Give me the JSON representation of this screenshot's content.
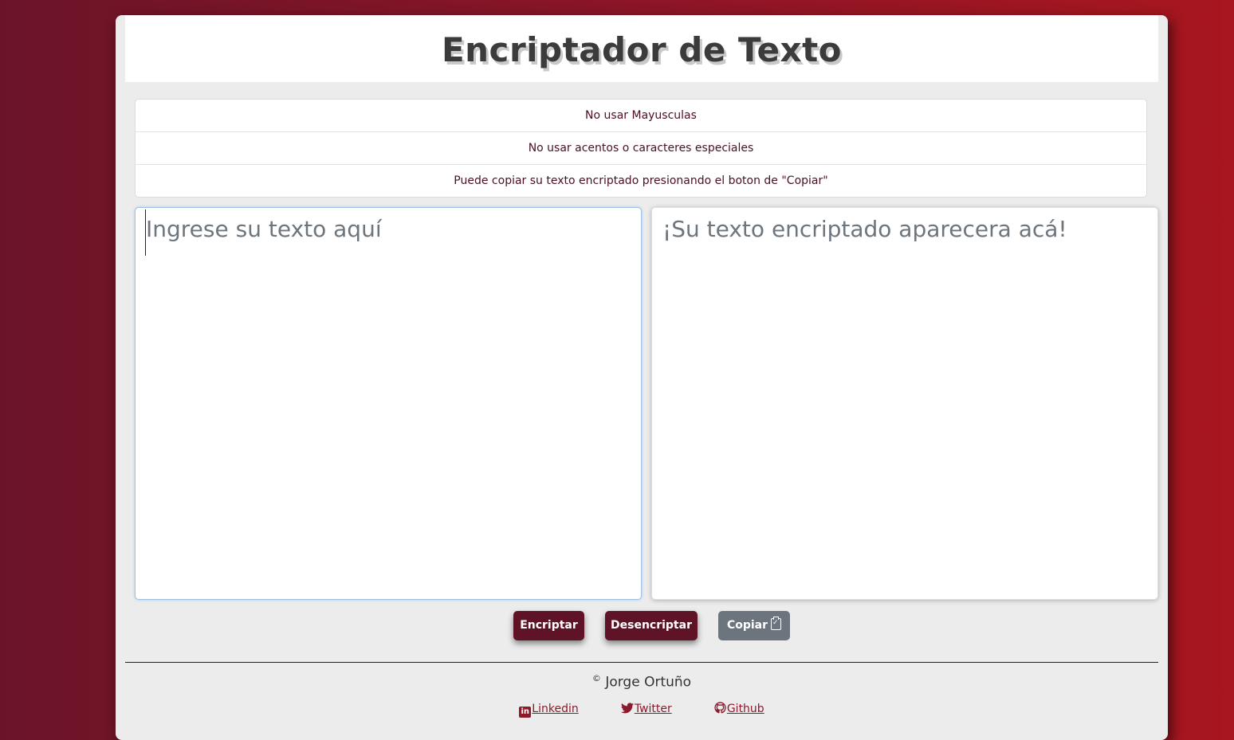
{
  "header": {
    "title": "Encriptador de Texto"
  },
  "rules": [
    {
      "text": "No usar Mayusculas"
    },
    {
      "text": "No usar acentos o caracteres especiales"
    },
    {
      "text": "Puede copiar su texto encriptado presionando el boton de \"Copiar\""
    }
  ],
  "input": {
    "placeholder": "Ingrese su texto aquí",
    "value": ""
  },
  "output": {
    "placeholder": "¡Su texto encriptado aparecera acá!",
    "value": ""
  },
  "buttons": {
    "encrypt_label": "Encriptar",
    "decrypt_label": "Desencriptar",
    "copy_label": "Copiar"
  },
  "footer": {
    "copyright_symbol": "©",
    "author": "Jorge Ortuño",
    "links": [
      {
        "label": "Linkedin",
        "icon": "linkedin-icon"
      },
      {
        "label": "Twitter",
        "icon": "twitter-icon"
      },
      {
        "label": "Github",
        "icon": "github-icon"
      }
    ]
  },
  "colors": {
    "accent": "#5e1426",
    "link": "#8b1a2b",
    "secondary_button": "#6c757d",
    "background_gradient_start": "#6b1428",
    "background_gradient_end": "#a8161f"
  }
}
